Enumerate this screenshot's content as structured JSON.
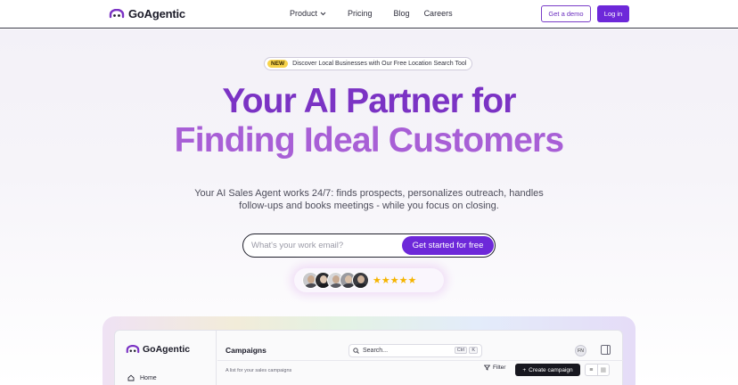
{
  "nav": {
    "brand": "GoAgentic",
    "links": [
      {
        "label": "Product",
        "has_dropdown": true
      },
      {
        "label": "Pricing"
      },
      {
        "label": "Blog"
      },
      {
        "label": "Careers"
      }
    ],
    "demo_label": "Get a demo",
    "login_label": "Log in"
  },
  "announcement": {
    "tag": "NEW",
    "text": "Discover Local Businesses with Our Free Location Search Tool"
  },
  "hero": {
    "line1": "Your AI Partner for",
    "line2": "Finding Ideal Customers",
    "subtitle_line1": "Your AI Sales Agent works 24/7: finds prospects, personalizes outreach, handles",
    "subtitle_line2": "follow-ups and books meetings - while you focus on closing."
  },
  "signup": {
    "placeholder": "What's your work email?",
    "button_label": "Get started for free"
  },
  "social_proof": {
    "avatar_count": 5,
    "rating": 5,
    "stars": "★★★★★"
  },
  "app_preview": {
    "brand": "GoAgentic",
    "nav_home": "Home",
    "page_title": "Campaigns",
    "search_placeholder": "Search...",
    "shortcut_keys": [
      "Ctrl",
      "K"
    ],
    "user_initials": "FN",
    "subtitle": "A list for your sales campaigns",
    "filter_label": "Filter",
    "create_label": "Create campaign"
  },
  "colors": {
    "primary": "#6d28d9",
    "headline_1": "#7b33c4",
    "headline_2": "#a85fd6",
    "badge_yellow": "#f7d34a",
    "star": "#f5b400"
  },
  "icons": [
    "logo-icon",
    "chevron-down-icon",
    "search-icon",
    "home-icon",
    "filter-icon",
    "plus-icon",
    "list-view-icon",
    "grid-view-icon",
    "panel-icon",
    "star-icon"
  ]
}
